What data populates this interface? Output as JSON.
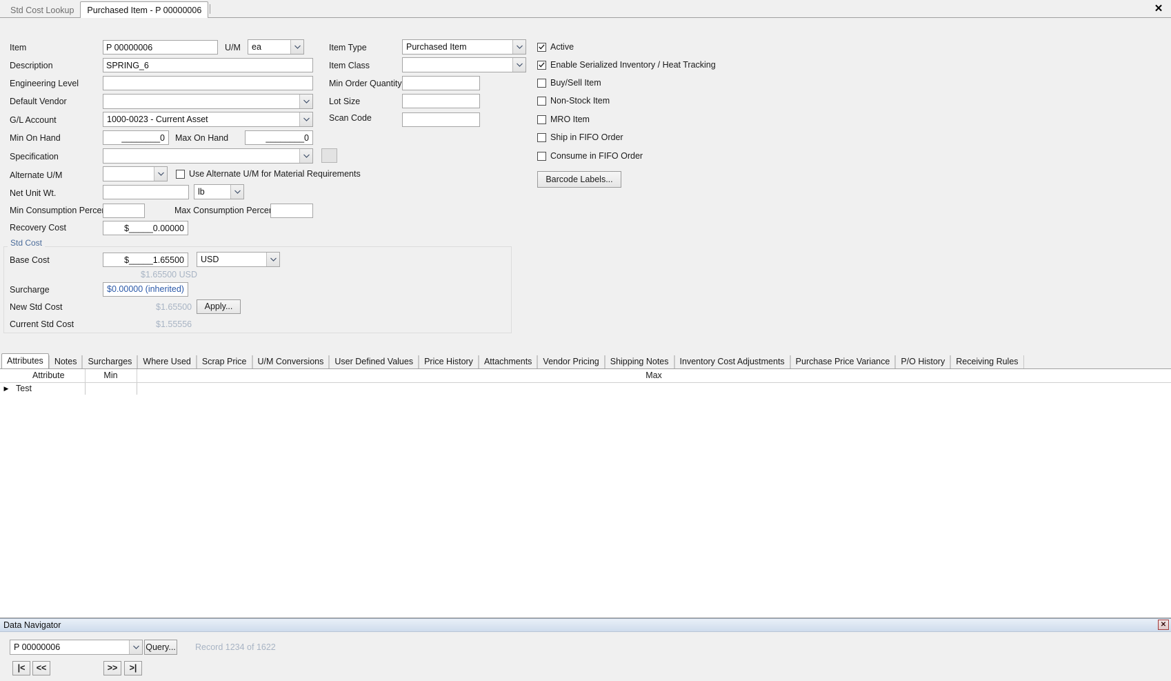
{
  "window": {
    "close_label": "✕",
    "doc_tabs": [
      {
        "label": "Std Cost Lookup",
        "active": false
      },
      {
        "label": "Purchased Item - P 00000006",
        "active": true
      }
    ]
  },
  "form": {
    "left": {
      "item_label": "Item",
      "item_value": "P 00000006",
      "um_label": "U/M",
      "um_value": "ea",
      "description_label": "Description",
      "description_value": "SPRING_6",
      "engineering_level_label": "Engineering Level",
      "engineering_level_value": "",
      "default_vendor_label": "Default Vendor",
      "default_vendor_value": "",
      "gl_account_label": "G/L Account",
      "gl_account_value": "1000-0023 - Current Asset",
      "min_on_hand_label": "Min On Hand",
      "min_on_hand_value": "________0",
      "max_on_hand_label": "Max On Hand",
      "max_on_hand_value": "________0",
      "specification_label": "Specification",
      "specification_value": "",
      "alternate_um_label": "Alternate U/M",
      "alternate_um_value": "",
      "use_alternate_um_label": "Use Alternate U/M for Material Requirements",
      "net_unit_wt_label": "Net Unit Wt.",
      "net_unit_wt_value": "",
      "net_unit_wt_uom": "lb",
      "min_consumption_label": "Min Consumption Percent",
      "min_consumption_value": "",
      "max_consumption_label": "Max Consumption Percent",
      "max_consumption_value": "",
      "recovery_cost_label": "Recovery Cost",
      "recovery_cost_value": "$_____0.00000"
    },
    "middle": {
      "item_type_label": "Item Type",
      "item_type_value": "Purchased Item",
      "item_class_label": "Item Class",
      "item_class_value": "",
      "min_order_qty_label": "Min Order Quantity",
      "min_order_qty_value": "",
      "lot_size_label": "Lot Size",
      "lot_size_value": "",
      "scan_code_label": "Scan Code",
      "scan_code_value": ""
    },
    "checkboxes": [
      {
        "label": "Active",
        "checked": true
      },
      {
        "label": "Enable Serialized Inventory / Heat Tracking",
        "checked": true
      },
      {
        "label": "Buy/Sell Item",
        "checked": false
      },
      {
        "label": "Non-Stock Item",
        "checked": false
      },
      {
        "label": "MRO Item",
        "checked": false
      },
      {
        "label": "Ship in FIFO Order",
        "checked": false
      },
      {
        "label": "Consume in FIFO Order",
        "checked": false
      }
    ],
    "barcode_button": "Barcode Labels...",
    "std_cost": {
      "group_title": "Std Cost",
      "base_cost_label": "Base Cost",
      "base_cost_value": "$_____1.65500",
      "currency_value": "USD",
      "base_cost_converted": "$1.65500 USD",
      "surcharge_label": "Surcharge",
      "surcharge_value": "$0.00000 (inherited)",
      "new_std_cost_label": "New Std Cost",
      "new_std_cost_value": "$1.65500",
      "apply_button": "Apply...",
      "current_std_cost_label": "Current Std Cost",
      "current_std_cost_value": "$1.55556"
    }
  },
  "bottom_tabs": [
    {
      "label": "Attributes",
      "active": true
    },
    {
      "label": "Notes",
      "active": false
    },
    {
      "label": "Surcharges",
      "active": false
    },
    {
      "label": "Where Used",
      "active": false
    },
    {
      "label": "Scrap Price",
      "active": false
    },
    {
      "label": "U/M Conversions",
      "active": false
    },
    {
      "label": "User Defined Values",
      "active": false
    },
    {
      "label": "Price History",
      "active": false
    },
    {
      "label": "Attachments",
      "active": false
    },
    {
      "label": "Vendor Pricing",
      "active": false
    },
    {
      "label": "Shipping Notes",
      "active": false
    },
    {
      "label": "Inventory Cost Adjustments",
      "active": false
    },
    {
      "label": "Purchase Price Variance",
      "active": false
    },
    {
      "label": "P/O History",
      "active": false
    },
    {
      "label": "Receiving Rules",
      "active": false
    }
  ],
  "grid": {
    "columns": [
      "Attribute",
      "Min",
      "Max"
    ],
    "rows": [
      {
        "indicator": "▶",
        "attribute": "Test",
        "min": "",
        "max": ""
      }
    ]
  },
  "navigator": {
    "title": "Data Navigator",
    "close_label": "✕",
    "record_combo_value": "P 00000006",
    "query_button": "Query...",
    "record_status": "Record 1234 of 1622",
    "first_button": "|<",
    "prev_button": "<<",
    "next_button": ">>",
    "last_button": ">|"
  }
}
